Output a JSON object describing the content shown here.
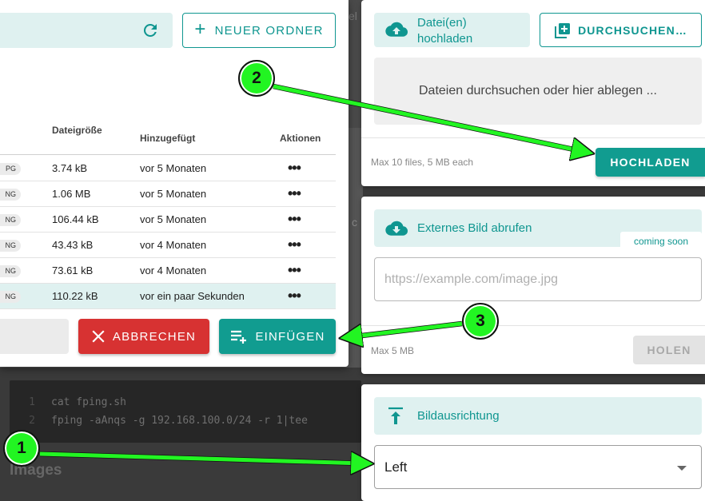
{
  "background": {
    "code_lines": [
      {
        "num": "1",
        "text": "cat fping.sh"
      },
      {
        "num": "2",
        "text": "fping -aAnqs -g  192.168.100.0/24  -r 1|tee "
      }
    ],
    "heading": "Images",
    "fragment_top": "el",
    "fragment_mid": "c"
  },
  "dialog": {
    "new_folder_label": "NEUER ORDNER",
    "columns": {
      "size": "Dateigröße",
      "added": "Hinzugefügt",
      "actions": "Aktionen"
    },
    "rows": [
      {
        "type": "PG",
        "size": "3.74 kB",
        "added": "vor 5 Monaten",
        "dots": "•••"
      },
      {
        "type": "NG",
        "size": "1.06 MB",
        "added": "vor 5 Monaten",
        "dots": "•••"
      },
      {
        "type": "NG",
        "size": "106.44 kB",
        "added": "vor 5 Monaten",
        "dots": "•••"
      },
      {
        "type": "NG",
        "size": "43.43 kB",
        "added": "vor 4 Monaten",
        "dots": "•••"
      },
      {
        "type": "NG",
        "size": "73.61 kB",
        "added": "vor 4 Monaten",
        "dots": "•••"
      },
      {
        "type": "NG",
        "size": "110.22 kB",
        "added": "vor ein paar Sekunden",
        "dots": "•••",
        "selected": true
      }
    ],
    "cancel_label": "ABBRECHEN",
    "insert_label": "EINFÜGEN"
  },
  "upload": {
    "upload_line1": "Datei(en)",
    "upload_line2": "hochladen",
    "browse_label": "DURCHSUCHEN…",
    "dropzone_text": "Dateien durchsuchen oder hier ablegen ...",
    "hint": "Max 10 files, 5 MB each",
    "upload_button": "HOCHLADEN"
  },
  "external": {
    "title": "Externes Bild abrufen",
    "badge": "coming soon",
    "placeholder": "https://example.com/image.jpg",
    "hint": "Max 5 MB",
    "fetch_button": "HOLEN"
  },
  "alignment": {
    "title": "Bildausrichtung",
    "selected": "Left"
  },
  "callouts": [
    "1",
    "2",
    "3"
  ],
  "colors": {
    "teal": "#119c90",
    "tint": "#dff1f0",
    "red": "#d73232",
    "annotation_green": "#22f522"
  }
}
